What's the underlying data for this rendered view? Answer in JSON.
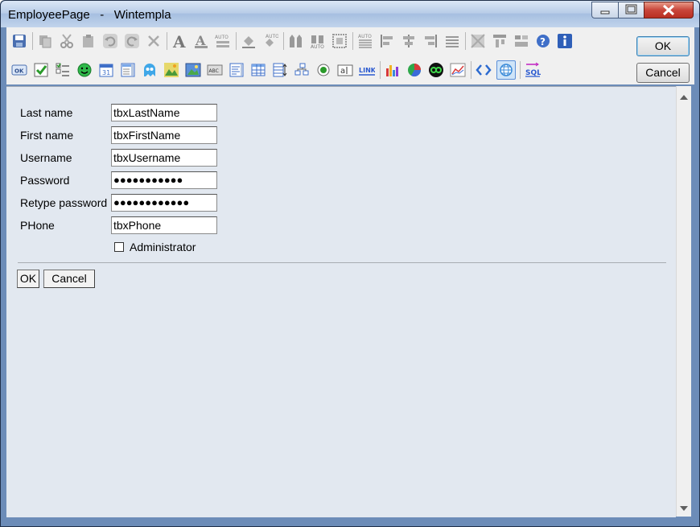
{
  "window": {
    "title": "EmployeePage   -   Wintempla",
    "controls": [
      "minimize-icon",
      "maximize-icon",
      "close-icon"
    ]
  },
  "toolbar": {
    "row1": [
      "save-icon",
      "copy-icon",
      "cut-icon",
      "paste-icon",
      "undo-icon",
      "redo-icon",
      "delete-icon",
      "font-icon",
      "font-outline-icon",
      "font-auto-icon",
      "fill-icon",
      "fill-auto-icon",
      "bring-front-icon",
      "size-auto-icon",
      "frame-icon",
      "align-auto-icon",
      "align-left-icon",
      "align-center-icon",
      "align-right-icon",
      "align-justify-icon",
      "grid-icon",
      "tab-order-icon",
      "layout-icon",
      "help-icon",
      "info-icon"
    ],
    "row2": [
      "ok-button-icon",
      "checkbox-icon",
      "checklist-icon",
      "smiley-icon",
      "calendar-icon",
      "listbox-icon",
      "ghost-icon",
      "image-icon",
      "picture-icon",
      "label-abc-icon",
      "textbox-icon",
      "table-icon",
      "grid-edit-icon",
      "treeview-icon",
      "radio-icon",
      "textfield-icon",
      "link-icon",
      "bar-chart-icon",
      "pie-chart-icon",
      "infinity-icon",
      "line-chart-icon",
      "code-icon",
      "web-icon",
      "sql-icon"
    ],
    "link_text": "LINK",
    "sql_text": "SQL",
    "calendar_text": "31",
    "abc_text": "ABC",
    "auto_text": "AUTO",
    "ok_text": "OK",
    "ok_label": "OK",
    "cancel_label": "Cancel"
  },
  "form": {
    "fields": [
      {
        "label": "Last name",
        "value": "tbxLastName"
      },
      {
        "label": "First name",
        "value": "tbxFirstName"
      },
      {
        "label": "Username",
        "value": "tbxUsername"
      },
      {
        "label": "Password",
        "value": "●●●●●●●●●●●"
      },
      {
        "label": "Retype password",
        "value": "●●●●●●●●●●●●"
      },
      {
        "label": "PHone",
        "value": "tbxPhone"
      }
    ],
    "checkbox_label": "Administrator",
    "checkbox_checked": false,
    "ok_label": "OK",
    "cancel_label": "Cancel"
  },
  "colors": {
    "canvas": "#e2e8f0",
    "toolbar": "#f0f0f0",
    "frame": "#6c8cb8"
  }
}
